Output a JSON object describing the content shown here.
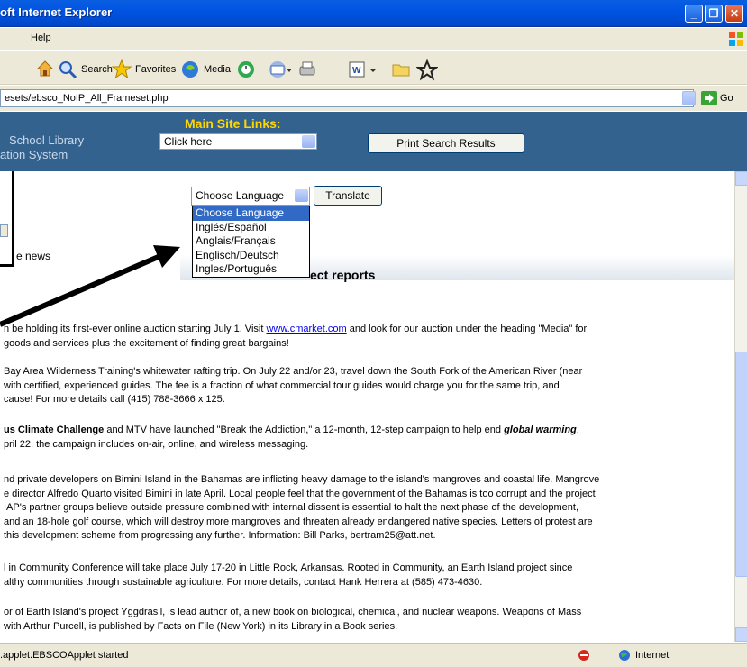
{
  "window": {
    "title": "oft Internet Explorer"
  },
  "menubar": {
    "help_label": "Help"
  },
  "toolbar": {
    "search_label": "Search",
    "favorites_label": "Favorites",
    "media_label": "Media"
  },
  "addressbar": {
    "url": "esets/ebsco_NoIP_All_Frameset.php",
    "go_label": "Go"
  },
  "site_header": {
    "name_line1": "School Library",
    "name_line2": "ation System",
    "main_links_label": "Main Site Links:",
    "main_links_select_value": "Click here",
    "print_button_label": "Print Search Results",
    "bg_color": "#33628f",
    "label_color": "#ffd700"
  },
  "translate": {
    "selected_language": "Choose Language",
    "button_label": "Translate",
    "options": [
      "Choose Language",
      "Inglés/Español",
      "Anglais/Français",
      "Englisch/Deutsch",
      "Ingles/Português"
    ]
  },
  "content": {
    "news_link_label": "e news",
    "section_title": "ect reports",
    "paragraphs": [
      {
        "pre": "n be holding its first-ever online auction starting July 1. Visit ",
        "link": "www.cmarket.com",
        "post": " and look for our auction under the heading \"Media\" for",
        "line2": "goods and services plus the excitement of finding great bargains!"
      },
      {
        "line1": "Bay Area Wilderness Training's whitewater rafting trip. On July 22 and/or 23, travel down the South Fork of the American River (near",
        "line2": " with certified, experienced guides. The fee is a fraction of what commercial tour guides would charge you for the same trip, and",
        "line3": "cause! For more details call (415) 788-3666 x 125."
      },
      {
        "bold1": "us Climate Challenge",
        "mid": " and MTV have launched \"Break the Addiction,\" a 12-month, 12-step campaign to help end ",
        "bold2": "global warming",
        "end": ".",
        "line2": "pril 22, the campaign includes on-air, online, and wireless messaging."
      },
      {
        "line1": "nd private developers on Bimini Island in the Bahamas are inflicting heavy damage to the island's mangroves and coastal life. Mangrove",
        "line2": "e director Alfredo Quarto visited Bimini in late April. Local people feel that the government of the Bahamas is too corrupt and the project",
        "line3": "IAP's partner groups believe outside pressure combined with internal dissent is essential to halt the next phase of the development,",
        "line4": "and an 18-hole golf course, which will destroy more mangroves and threaten already endangered native species. Letters of protest are",
        "line5": " this development scheme from progressing any further. Information: Bill Parks, bertram25@att.net."
      },
      {
        "line1": "l in Community Conference will take place July 17-20 in Little Rock, Arkansas. Rooted in Community, an Earth Island project since",
        "line2": "althy communities through sustainable agriculture. For more details, contact Hank Herrera at (585) 473-4630."
      },
      {
        "line1": "or of Earth Island's project Yggdrasil, is lead author of, a new book on biological, chemical, and nuclear weapons. Weapons of Mass",
        "line2": "with Arthur Purcell, is published by Facts on File (New York) in its Library in a Book series."
      }
    ]
  },
  "statusbar": {
    "text": ".applet.EBSCOApplet started",
    "zone_label": "Internet"
  }
}
